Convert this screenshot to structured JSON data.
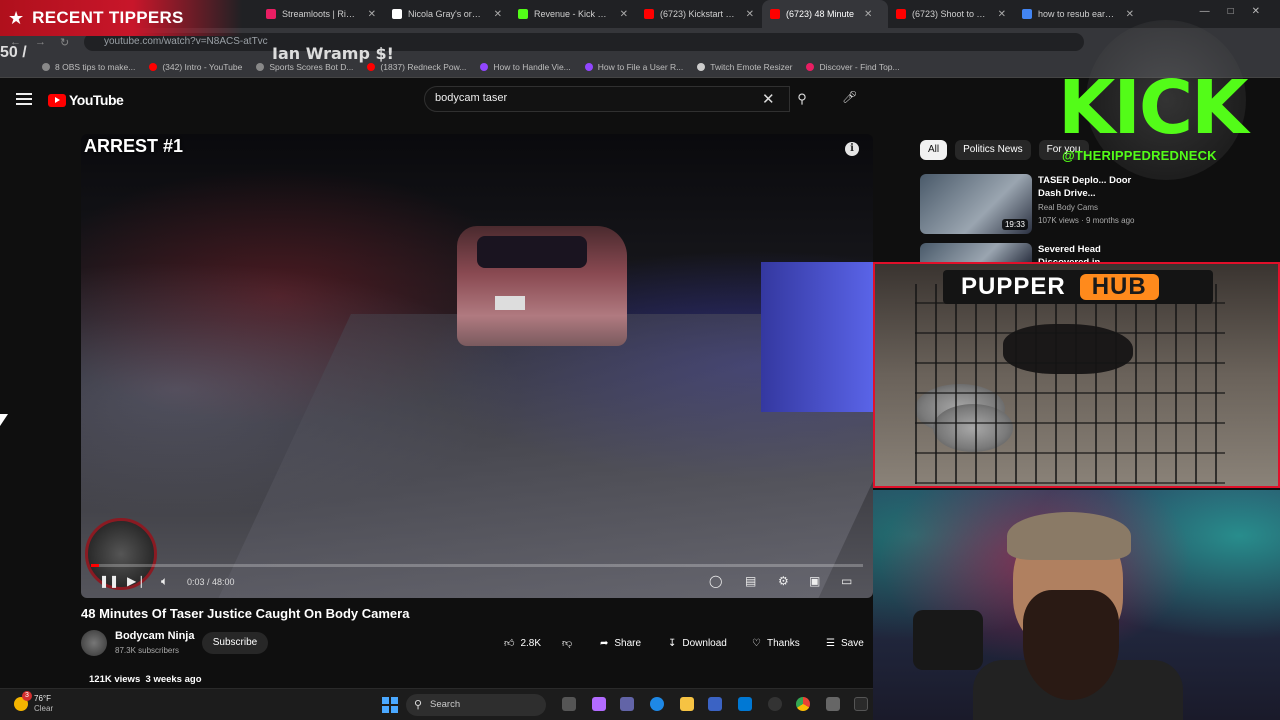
{
  "browser": {
    "tabs": [
      {
        "title": "Streamloots | Ripped...",
        "color": "#e91e63"
      },
      {
        "title": "Nicola Gray's order (#",
        "color": "#ffffff"
      },
      {
        "title": "Revenue - Kick Dashb",
        "color": "#53fc18"
      },
      {
        "title": "(6723) Kickstart My H",
        "color": "#ff0000"
      },
      {
        "title": "(6723) 48 Minute",
        "color": "#ff0000",
        "active": true
      },
      {
        "title": "(6723) Shoot to Thrill",
        "color": "#ff0000"
      },
      {
        "title": "how to resub early on",
        "color": "#4285f4"
      }
    ],
    "url": "youtube.com/watch?v=N8ACS-atTvc",
    "bookmarks": [
      {
        "label": "8 OBS tips to make...",
        "color": "#888888"
      },
      {
        "label": "(342) Intro - YouTube",
        "color": "#ff0000"
      },
      {
        "label": "Sports Scores Bot D...",
        "color": "#888888"
      },
      {
        "label": "(1837) Redneck Pow...",
        "color": "#ff0000"
      },
      {
        "label": "How to Handle Vie...",
        "color": "#9146ff"
      },
      {
        "label": "How to File a User R...",
        "color": "#9146ff"
      },
      {
        "label": "Twitch Emote Resizer",
        "color": "#cccccc"
      },
      {
        "label": "Discover - Find Top...",
        "color": "#e91e63"
      }
    ]
  },
  "youtube": {
    "logo_text": "YouTube",
    "search_value": "bodycam taser",
    "player": {
      "overlay_title": "ARREST #1",
      "current_time": "0:03",
      "duration": "48:00",
      "time_display": "0:03 / 48:00",
      "progress_fraction": 0.01
    },
    "video": {
      "title": "48 Minutes Of Taser Justice Caught On Body Camera",
      "channel": "Bodycam Ninja",
      "subscribers": "87.3K subscribers",
      "subscribe_label": "Subscribe",
      "likes": "2.8K",
      "share_label": "Share",
      "download_label": "Download",
      "thanks_label": "Thanks",
      "save_label": "Save",
      "views": "121K views",
      "age": "3 weeks ago"
    },
    "sidebar": {
      "chips": [
        "All",
        "Politics News",
        "For you"
      ],
      "recommendations": [
        {
          "title": "TASER Deplo... Door Dash Drive...",
          "channel": "Real Body Cams",
          "meta": "107K views · 9 months ago",
          "duration": "19:33"
        },
        {
          "title": "Severed Head Discovered in Gruesome New Mexico Crime",
          "channel": "",
          "meta": "",
          "duration": ""
        }
      ]
    }
  },
  "overlays": {
    "recent_tippers": "RECENT TIPPERS",
    "ticker_left": "50 /",
    "ticker": "Ian Wramp $!",
    "kick_logo": "KICK",
    "kick_handle": "@THERIPPEDREDNECK",
    "pupper_word": "PUPPER",
    "hub_word": "HUB",
    "colors": {
      "kick_green": "#53fc18",
      "tipper_red": "#c8162a",
      "hub_orange": "#ff8a1c",
      "frame_red": "#e0102a"
    }
  },
  "taskbar": {
    "weather_temp": "76°F",
    "weather_cond": "Clear",
    "weather_badge": "3",
    "search_label": "Search"
  }
}
